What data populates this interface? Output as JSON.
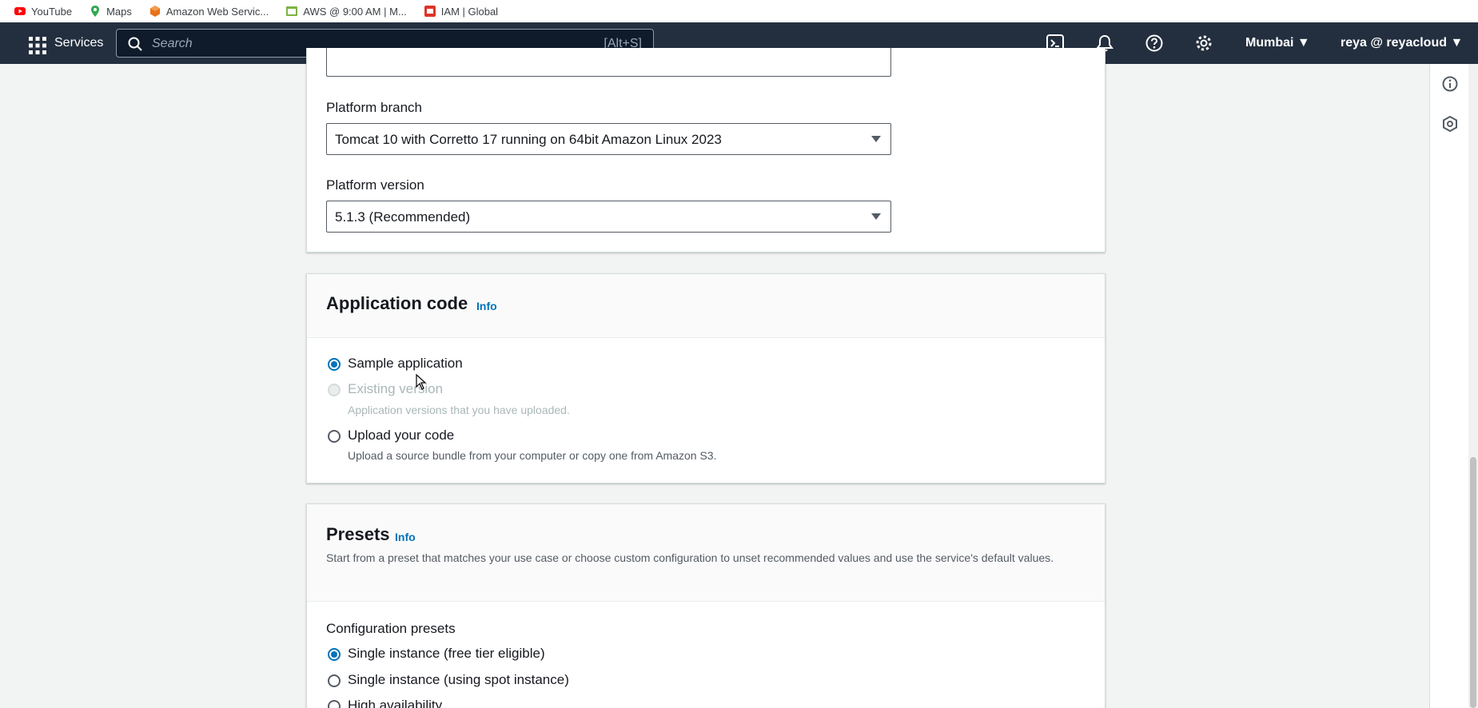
{
  "bookmarks": [
    {
      "label": "YouTube",
      "icon": "youtube-icon",
      "color": "#ff0000"
    },
    {
      "label": "Maps",
      "icon": "maps-pin-icon",
      "color": "#34a853"
    },
    {
      "label": "Amazon Web Servic...",
      "icon": "aws-cube-icon",
      "color": "#e8711a"
    },
    {
      "label": "AWS @ 9:00 AM | M...",
      "icon": "calendar-icon",
      "color": "#7cb342"
    },
    {
      "label": "IAM | Global",
      "icon": "iam-icon",
      "color": "#dd3427"
    }
  ],
  "nav": {
    "services_label": "Services",
    "search_placeholder": "Search",
    "search_shortcut": "[Alt+S]",
    "region": "Mumbai",
    "user": "reya @ reyacloud",
    "background": "#232f3e"
  },
  "platform": {
    "branch_label": "Platform branch",
    "branch_value": "Tomcat 10 with Corretto 17 running on 64bit Amazon Linux 2023",
    "version_label": "Platform version",
    "version_value": "5.1.3 (Recommended)"
  },
  "app_code": {
    "title": "Application code",
    "info": "Info",
    "options": [
      {
        "label": "Sample application",
        "selected": true,
        "disabled": false,
        "description": ""
      },
      {
        "label": "Existing version",
        "selected": false,
        "disabled": true,
        "description": "Application versions that you have uploaded."
      },
      {
        "label": "Upload your code",
        "selected": false,
        "disabled": false,
        "description": "Upload a source bundle from your computer or copy one from Amazon S3."
      }
    ]
  },
  "presets": {
    "title": "Presets",
    "info": "Info",
    "description": "Start from a preset that matches your use case or choose custom configuration to unset recommended values and use the service's default values.",
    "config_label": "Configuration presets",
    "options": [
      {
        "label": "Single instance (free tier eligible)",
        "selected": true
      },
      {
        "label": "Single instance (using spot instance)",
        "selected": false
      },
      {
        "label": "High availability",
        "selected": false
      }
    ]
  },
  "accent_color": "#0073bb"
}
